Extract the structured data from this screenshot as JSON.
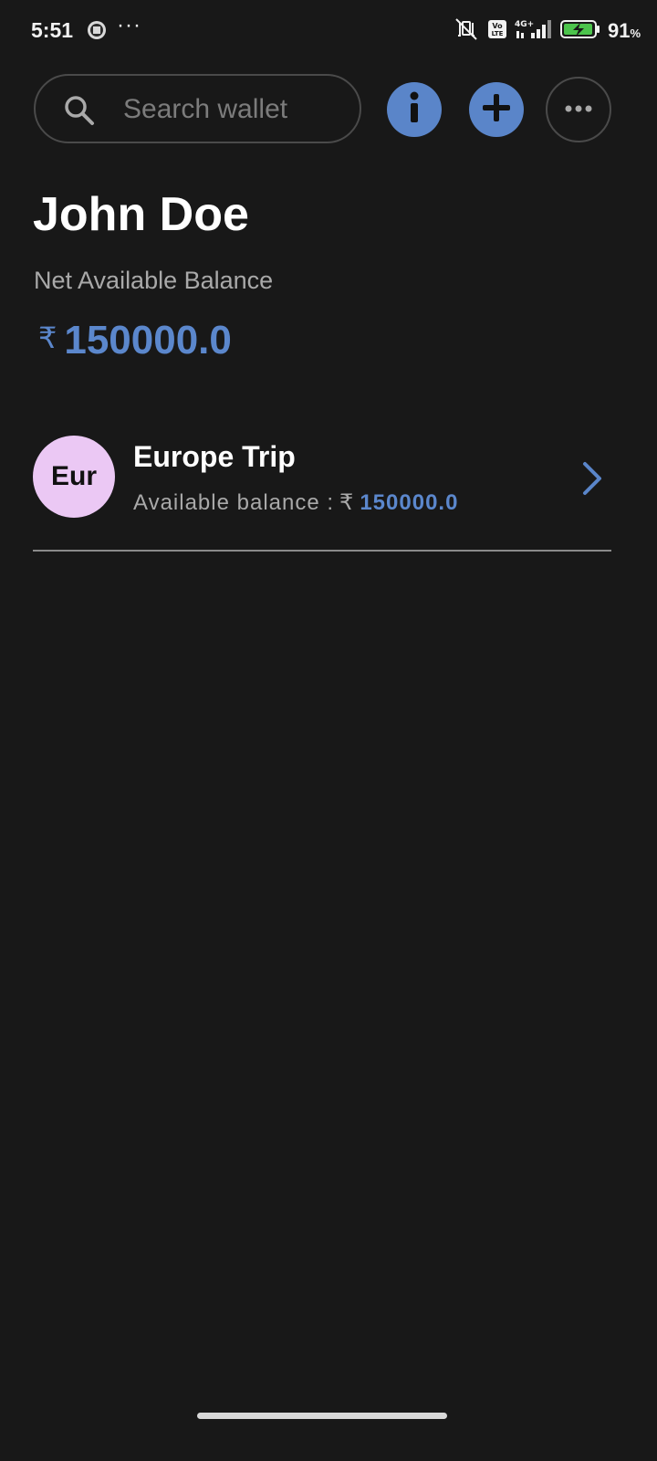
{
  "status_bar": {
    "time": "5:51",
    "dots": "···",
    "battery_percent": "91",
    "percent_sign": "%",
    "network": "4G+",
    "volte": "Vo LTE"
  },
  "search": {
    "placeholder": "Search wallet",
    "value": ""
  },
  "actions": {
    "info_icon": "info-icon",
    "add_icon": "plus-icon",
    "more_icon": "more-horizontal-icon"
  },
  "header": {
    "user_name": "John Doe",
    "balance_label": "Net Available Balance",
    "currency_symbol": "₹",
    "net_balance": "150000.0"
  },
  "wallets": [
    {
      "avatar_text": "Eur",
      "name": "Europe Trip",
      "balance_label": "Available balance :",
      "currency_symbol": "₹",
      "balance": "150000.0"
    }
  ],
  "colors": {
    "background": "#181818",
    "accent": "#5a85c9",
    "avatar_bg": "#ebc8f4",
    "muted_text": "#a9a9a9"
  }
}
